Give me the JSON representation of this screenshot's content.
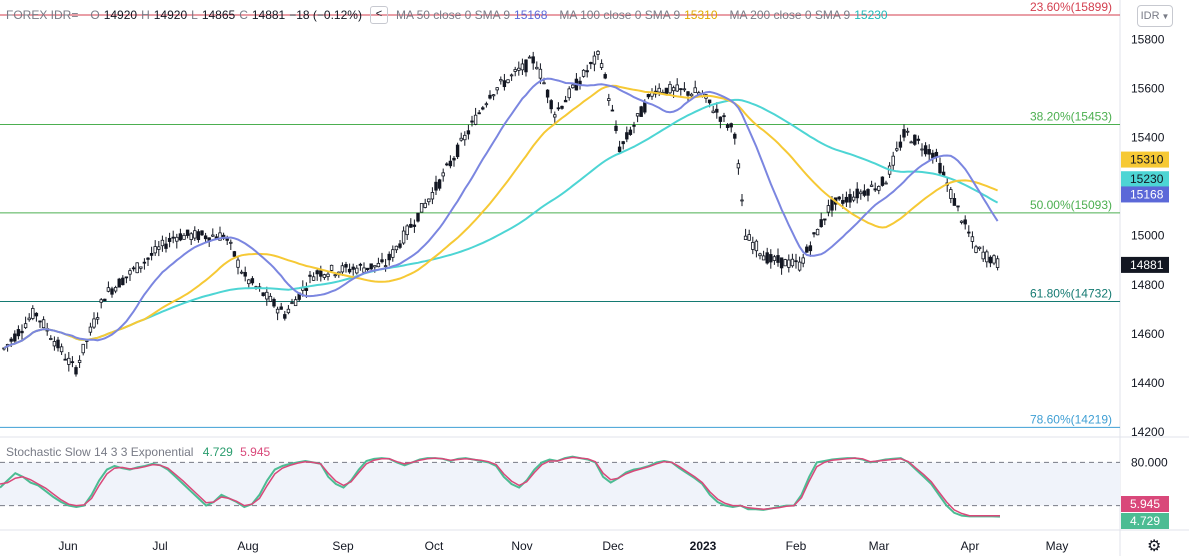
{
  "header": {
    "symbol": "FOREX IDR=",
    "o_label": "O",
    "o_value": "14920",
    "h_label": "H",
    "h_value": "14920",
    "l_label": "L",
    "l_value": "14865",
    "c_label": "C",
    "c_value": "14881",
    "change": "−18 (−0.12%)",
    "collapse_icon": "<",
    "ma50_label": "MA 50 close 0 SMA 9",
    "ma50_value": "15168",
    "ma100_label": "MA 100 close 0 SMA 9",
    "ma100_value": "15310",
    "ma200_label": "MA 200 close 0 SMA 9",
    "ma200_value": "15230"
  },
  "currency_button": "IDR",
  "indicator": {
    "label": "Stochastic Slow 14 3 3 Exponential",
    "k": "4.729",
    "d": "5.945"
  },
  "colors": {
    "ma50": "#7b86e0",
    "ma100": "#f6c935",
    "ma200": "#4dd5d4",
    "stoch_k": "#4cbc93",
    "stoch_d": "#d9487a",
    "fib_23": "#d33e4e",
    "fib_38": "#4caf50",
    "fib_50": "#4caf50",
    "fib_618": "#147a72",
    "fib_786": "#3f9fd4",
    "candle": "#131722"
  },
  "chart_data": {
    "type": "candlestick",
    "y_axis_ticks": [
      15800,
      15600,
      15400,
      15200,
      15000,
      14800,
      14600,
      14400,
      14200
    ],
    "ylim": [
      14180,
      15960
    ],
    "x_axis_ticks": [
      "Jun",
      "Jul",
      "Aug",
      "Sep",
      "Oct",
      "Nov",
      "Dec",
      "2023",
      "Feb",
      "Mar",
      "Apr",
      "May"
    ],
    "last_price": "14881",
    "price_tags": [
      {
        "label": "15310",
        "value": 15310,
        "color": "#f6c935",
        "text_color": "#131722"
      },
      {
        "label": "15230",
        "value": 15230,
        "color": "#4dd5d4",
        "text_color": "#131722"
      },
      {
        "label": "15168",
        "value": 15168,
        "color": "#5b68d8",
        "text_color": "#ffffff"
      },
      {
        "label": "14881",
        "value": 14881,
        "color": "#131722",
        "text_color": "#ffffff"
      }
    ],
    "fib_levels": [
      {
        "label": "23.60%(15899)",
        "value": 15899,
        "color": "#d33e4e"
      },
      {
        "label": "38.20%(15453)",
        "value": 15453,
        "color": "#4caf50"
      },
      {
        "label": "50.00%(15093)",
        "value": 15093,
        "color": "#4caf50"
      },
      {
        "label": "61.80%(14732)",
        "value": 14732,
        "color": "#147a72"
      },
      {
        "label": "78.60%(14219)",
        "value": 14219,
        "color": "#3f9fd4"
      }
    ],
    "stochastic": {
      "k": [
        45,
        55,
        65,
        60,
        52,
        48,
        40,
        32,
        25,
        20,
        18,
        20,
        35,
        55,
        70,
        75,
        72,
        70,
        73,
        75,
        78,
        76,
        70,
        60,
        50,
        40,
        30,
        20,
        25,
        35,
        30,
        25,
        18,
        22,
        35,
        55,
        70,
        75,
        78,
        80,
        82,
        80,
        78,
        60,
        50,
        45,
        55,
        70,
        82,
        85,
        86,
        85,
        80,
        76,
        80,
        84,
        86,
        86,
        85,
        82,
        85,
        86,
        84,
        82,
        80,
        75,
        60,
        50,
        45,
        55,
        70,
        80,
        84,
        82,
        86,
        88,
        86,
        84,
        80,
        60,
        52,
        58,
        66,
        70,
        72,
        75,
        80,
        82,
        80,
        72,
        65,
        58,
        50,
        35,
        25,
        20,
        18,
        20,
        15,
        15,
        14,
        16,
        18,
        20,
        20,
        35,
        60,
        80,
        82,
        84,
        85,
        86,
        86,
        84,
        80,
        82,
        84,
        85,
        86,
        80,
        70,
        60,
        50,
        35,
        20,
        10,
        6,
        5,
        5,
        5,
        5,
        4.729
      ],
      "d": [
        50,
        52,
        58,
        60,
        56,
        50,
        44,
        36,
        28,
        22,
        20,
        21,
        30,
        48,
        64,
        72,
        73,
        71,
        72,
        74,
        77,
        76,
        72,
        63,
        54,
        44,
        34,
        24,
        25,
        32,
        30,
        26,
        20,
        22,
        30,
        48,
        64,
        72,
        76,
        79,
        81,
        80,
        78,
        65,
        54,
        48,
        53,
        66,
        78,
        83,
        85,
        85,
        81,
        78,
        80,
        83,
        85,
        86,
        85,
        83,
        84,
        85,
        84,
        83,
        81,
        77,
        64,
        54,
        48,
        53,
        66,
        77,
        82,
        82,
        85,
        87,
        86,
        85,
        81,
        65,
        56,
        58,
        64,
        68,
        71,
        74,
        78,
        81,
        80,
        74,
        67,
        60,
        52,
        39,
        29,
        23,
        20,
        20,
        17,
        16,
        15,
        16,
        17,
        19,
        20,
        31,
        54,
        74,
        80,
        83,
        84,
        85,
        86,
        85,
        81,
        82,
        83,
        84,
        85,
        81,
        72,
        63,
        53,
        39,
        25,
        14,
        9,
        6,
        6,
        6,
        6,
        5.945
      ],
      "upper": 80,
      "lower": 20,
      "axis_ticks": [
        "80.000"
      ],
      "k_tag": "4.729",
      "d_tag": "5.945"
    }
  }
}
